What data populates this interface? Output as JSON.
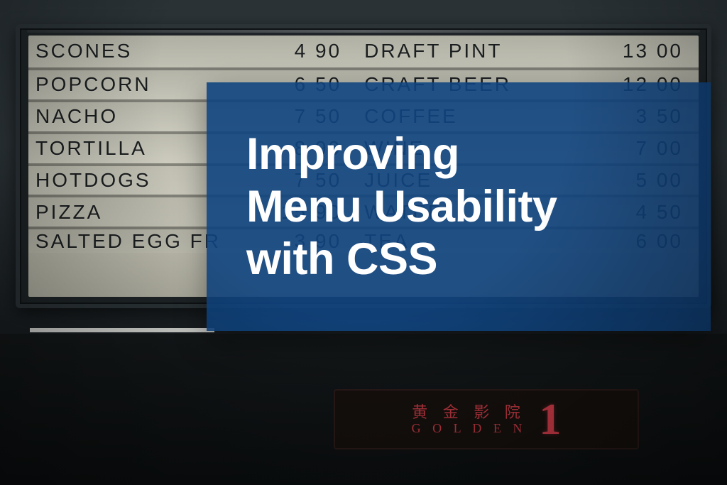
{
  "menu": {
    "rows": [
      {
        "left": "SCONES",
        "lprice": "4 90",
        "right": "DRAFT PINT",
        "rprice": "13 00"
      },
      {
        "left": "POPCORN",
        "lprice": "6 50",
        "right": "CRAFT BEER",
        "rprice": "12 00"
      },
      {
        "left": "NACHO",
        "lprice": "7 50",
        "right": "COFFEE",
        "rprice": "3 50"
      },
      {
        "left": "TORTILLA",
        "lprice": "8 90",
        "right": "WINE",
        "rprice": "7 00"
      },
      {
        "left": "HOTDOGS",
        "lprice": "7 50",
        "right": "JUICE",
        "rprice": "5 00"
      },
      {
        "left": "PIZZA",
        "lprice": "15 90",
        "right": "WATER",
        "rprice": "4 50"
      },
      {
        "left": "SALTED EGG FR",
        "lprice": "3 90",
        "right": "TEA",
        "rprice": "6 00"
      }
    ]
  },
  "cinema": {
    "chinese": "黄 金 影 院",
    "english": "G O L D E N",
    "number": "1"
  },
  "overlay": {
    "title_line1": "Improving",
    "title_line2": "Menu Usability",
    "title_line3": "with CSS"
  }
}
